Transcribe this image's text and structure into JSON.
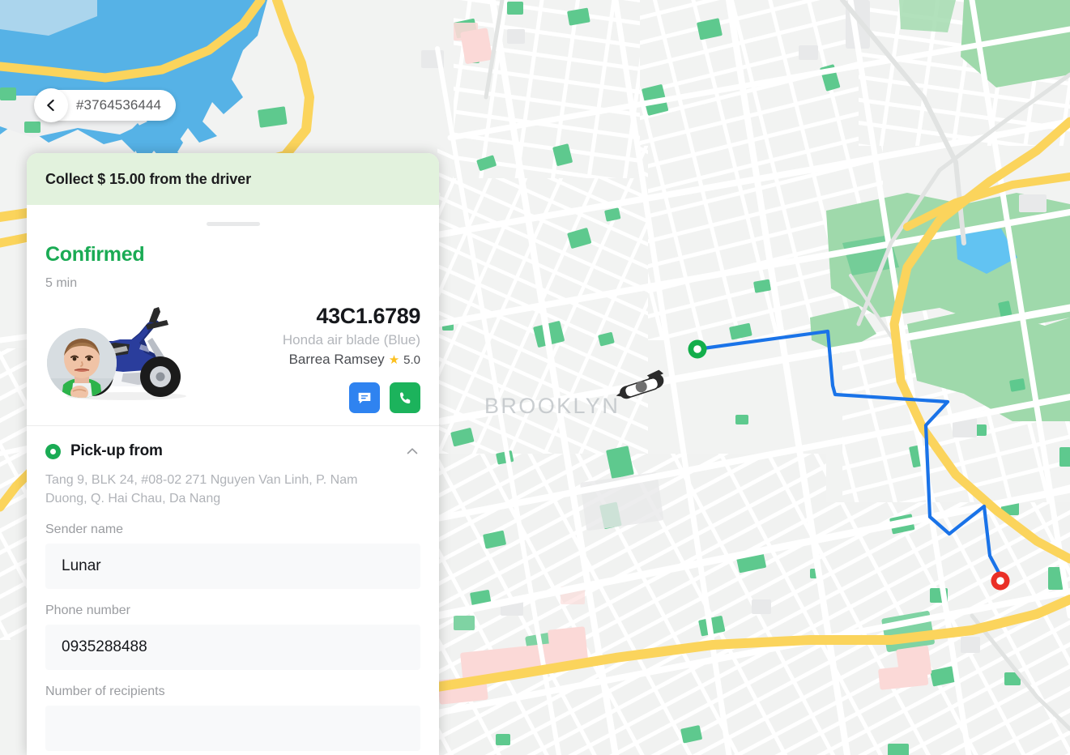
{
  "header": {
    "back_icon": "chevron-left-icon",
    "order_id": "#3764536444"
  },
  "panel": {
    "collect_banner": "Collect $ 15.00 from the driver",
    "status": "Confirmed",
    "eta": "5 min",
    "driver": {
      "plate": "43C1.6789",
      "vehicle": "Honda air blade (Blue)",
      "name": "Barrea Ramsey",
      "star_icon": "star-icon",
      "rating": "5.0",
      "chat_icon": "chat-bubble-icon",
      "call_icon": "phone-icon",
      "avatar_icon": "driver-avatar",
      "vehicle_icon": "motorbike-icon"
    },
    "pickup": {
      "marker_icon": "pickup-dot-icon",
      "title": "Pick-up from",
      "collapse_icon": "chevron-up-icon",
      "address": "Tang 9, BLK 24, #08-02 271 Nguyen Van Linh, P. Nam Duong, Q. Hai Chau, Da Nang",
      "fields": [
        {
          "label": "Sender name",
          "value": "Lunar"
        },
        {
          "label": "Phone number",
          "value": "0935288488"
        },
        {
          "label": "Number of recipients",
          "value": ""
        }
      ]
    }
  },
  "map": {
    "label_brooklyn": "BROOKLYN",
    "origin_marker_icon": "origin-marker-icon",
    "destination_marker_icon": "destination-marker-icon",
    "driver_marker_icon": "driver-scooter-icon",
    "colors": {
      "route": "#1a73e8",
      "origin": "#13ae4b",
      "destination": "#ea2f26",
      "water": "#56b2e6",
      "park": "#9fd9ab",
      "park_dark": "#58c48c",
      "highway": "#fbd45c",
      "land": "#f2f3f2",
      "road": "#ffffff"
    }
  },
  "theme": {
    "green_banner_bg": "#e2f2dd",
    "status_green": "#1aab54",
    "chat_blue": "#2f83f0",
    "call_green": "#1cb35c",
    "star_yellow": "#fcc01e"
  }
}
